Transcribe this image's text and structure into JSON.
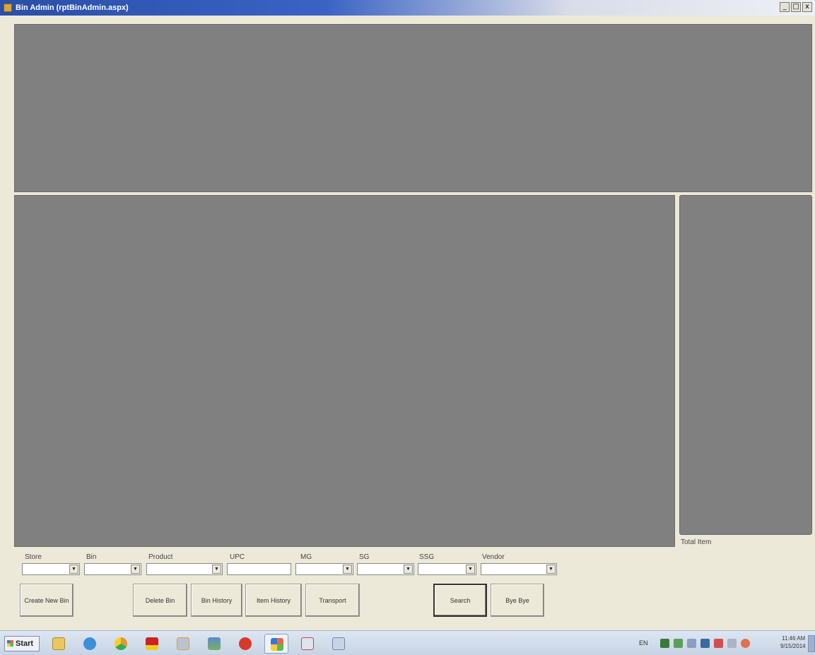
{
  "window": {
    "title": "Bin Admin (rptBinAdmin.aspx)",
    "controls": [
      "_",
      "□",
      "x"
    ]
  },
  "side_panel": {
    "total_label": "Total Item"
  },
  "filters": [
    {
      "label": "Store",
      "type": "dropdown",
      "value": ""
    },
    {
      "label": "Bin",
      "type": "dropdown",
      "value": ""
    },
    {
      "label": "Product",
      "type": "dropdown",
      "value": ""
    },
    {
      "label": "UPC",
      "type": "text",
      "value": ""
    },
    {
      "label": "MG",
      "type": "dropdown",
      "value": ""
    },
    {
      "label": "SG",
      "type": "dropdown",
      "value": ""
    },
    {
      "label": "SSG",
      "type": "dropdown",
      "value": ""
    },
    {
      "label": "Vendor",
      "type": "dropdown",
      "value": ""
    }
  ],
  "buttons": {
    "create_new_bin": "Create New Bin",
    "delete_bin": "Delete Bin",
    "bin_history": "Bin History",
    "item_history": "Item History",
    "transport": "Transport",
    "search": "Search",
    "bye_bye": "Bye Bye"
  },
  "taskbar": {
    "start_label": "Start",
    "language": "EN",
    "clock_time": "11:46 AM",
    "clock_date": "9/15/2014",
    "icons": [
      "folder-icon",
      "internet-explorer-icon",
      "chrome-icon",
      "sjuc-app-icon",
      "network-tool-icon",
      "image-viewer-icon",
      "pdf-icon",
      "windows-app-icon",
      "snipping-tool-icon",
      "calculator-icon"
    ]
  },
  "colors": {
    "panel": "#808080",
    "background": "#ece9d8",
    "titlebar": "#2a4fa8"
  }
}
